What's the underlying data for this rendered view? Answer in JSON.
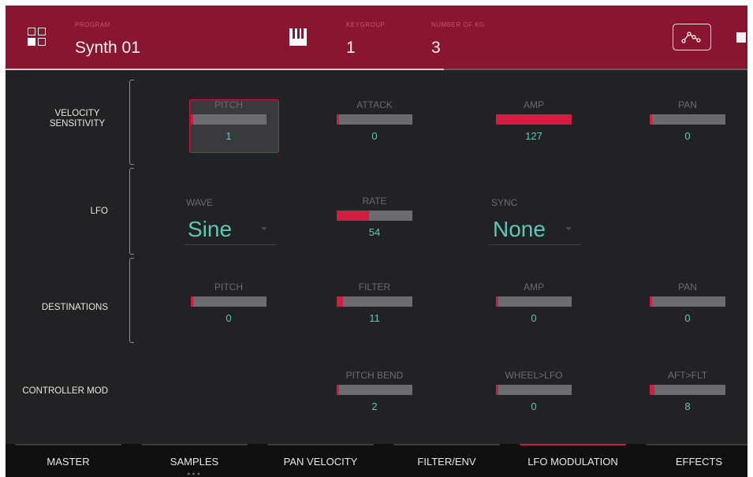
{
  "header": {
    "program_label": "PROGRAM",
    "program_name": "Synth 01",
    "keygroup_label": "KEYGROUP",
    "keygroup_value": "1",
    "number_label": "NUMBER OF KG",
    "number_value": "3",
    "icons": [
      "grid-icon",
      "piano-keys-icon",
      "envelope-icon",
      "chip-icon"
    ],
    "accent_color": "#8a1530"
  },
  "sections": {
    "velocity": "VELOCITY SENSITIVITY",
    "lfo": "LFO",
    "destinations": "DESTINATIONS",
    "controller": "CONTROLLER MOD"
  },
  "velocity": [
    {
      "label": "PITCH",
      "value": "1",
      "level": 0.01
    },
    {
      "label": "ATTACK",
      "value": "0",
      "level": 0
    },
    {
      "label": "AMP",
      "value": "127",
      "level": 1.0
    },
    {
      "label": "PAN",
      "value": "0",
      "level": 0
    }
  ],
  "lfo": {
    "wave_label": "WAVE",
    "wave_value": "Sine",
    "rate": {
      "label": "RATE",
      "value": "54",
      "level": 0.425
    },
    "sync_label": "SYNC",
    "sync_value": "None"
  },
  "destinations": [
    {
      "label": "PITCH",
      "value": "0",
      "level": 0
    },
    {
      "label": "FILTER",
      "value": "11",
      "level": 0.087
    },
    {
      "label": "AMP",
      "value": "0",
      "level": 0
    },
    {
      "label": "PAN",
      "value": "0",
      "level": 0
    }
  ],
  "controller": [
    {
      "label": "PITCH BEND",
      "value": "2",
      "level": 0.016
    },
    {
      "label": "WHEEL>LFO",
      "value": "0",
      "level": 0
    },
    {
      "label": "AFT>FLT",
      "value": "8",
      "level": 0.063
    }
  ],
  "tabs": [
    {
      "label": "MASTER",
      "active": false
    },
    {
      "label": "SAMPLES",
      "active": false
    },
    {
      "label": "PAN VELOCITY",
      "active": false
    },
    {
      "label": "FILTER/ENV",
      "active": false
    },
    {
      "label": "LFO MODULATION",
      "active": true
    },
    {
      "label": "EFFECTS",
      "active": false
    }
  ],
  "highlight_color": "#d01d42",
  "value_color": "#5ec7b7"
}
